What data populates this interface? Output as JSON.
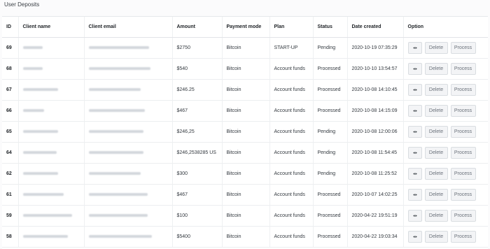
{
  "page": {
    "title": "User Deposits"
  },
  "table": {
    "headers": [
      "ID",
      "Client name",
      "Client email",
      "Amount",
      "Payment mode",
      "Plan",
      "Status",
      "Date created",
      "Option"
    ],
    "actions": {
      "delete_label": "Delete",
      "process_label": "Process"
    },
    "rows": [
      {
        "id": "69",
        "name_blur": 28,
        "email_blur": 86,
        "amount": "$2750",
        "mode": "Bitcoin",
        "plan": "START-UP",
        "status": "Pending",
        "date": "2020-10-19 07:35:29"
      },
      {
        "id": "68",
        "name_blur": 28,
        "email_blur": 88,
        "amount": "$540",
        "mode": "Bitcoin",
        "plan": "Account funds",
        "status": "Processed",
        "date": "2020-10-10 13:54:57"
      },
      {
        "id": "67",
        "name_blur": 50,
        "email_blur": 74,
        "amount": "$246.25",
        "mode": "Bitcoin",
        "plan": "Account funds",
        "status": "Processed",
        "date": "2020-10-08 14:10:45"
      },
      {
        "id": "66",
        "name_blur": 30,
        "email_blur": 80,
        "amount": "$467",
        "mode": "Bitcoin",
        "plan": "Account funds",
        "status": "Processed",
        "date": "2020-10-08 14:15:09"
      },
      {
        "id": "65",
        "name_blur": 50,
        "email_blur": 78,
        "amount": "$246,25",
        "mode": "Bitcoin",
        "plan": "Account funds",
        "status": "Pending",
        "date": "2020-10-08 12:00:06"
      },
      {
        "id": "64",
        "name_blur": 48,
        "email_blur": 78,
        "amount": "$246,2538285 US",
        "mode": "Bitcoin",
        "plan": "Account funds",
        "status": "Pending",
        "date": "2020-10-08 11:54:45"
      },
      {
        "id": "62",
        "name_blur": 50,
        "email_blur": 74,
        "amount": "$300",
        "mode": "Bitcoin",
        "plan": "Account funds",
        "status": "Pending",
        "date": "2020-10-08 11:25:52"
      },
      {
        "id": "61",
        "name_blur": 58,
        "email_blur": 84,
        "amount": "$467",
        "mode": "Bitcoin",
        "plan": "Account funds",
        "status": "Processed",
        "date": "2020-10-07 14:02:25"
      },
      {
        "id": "59",
        "name_blur": 70,
        "email_blur": 84,
        "amount": "$100",
        "mode": "Bitcoin",
        "plan": "Account funds",
        "status": "Processed",
        "date": "2020-04-22 19:51:19"
      },
      {
        "id": "58",
        "name_blur": 64,
        "email_blur": 90,
        "amount": "$5400",
        "mode": "Bitcoin",
        "plan": "Account funds",
        "status": "Processed",
        "date": "2020-04-22 19:03:34"
      }
    ]
  },
  "icons": {
    "view": "eye-icon"
  }
}
